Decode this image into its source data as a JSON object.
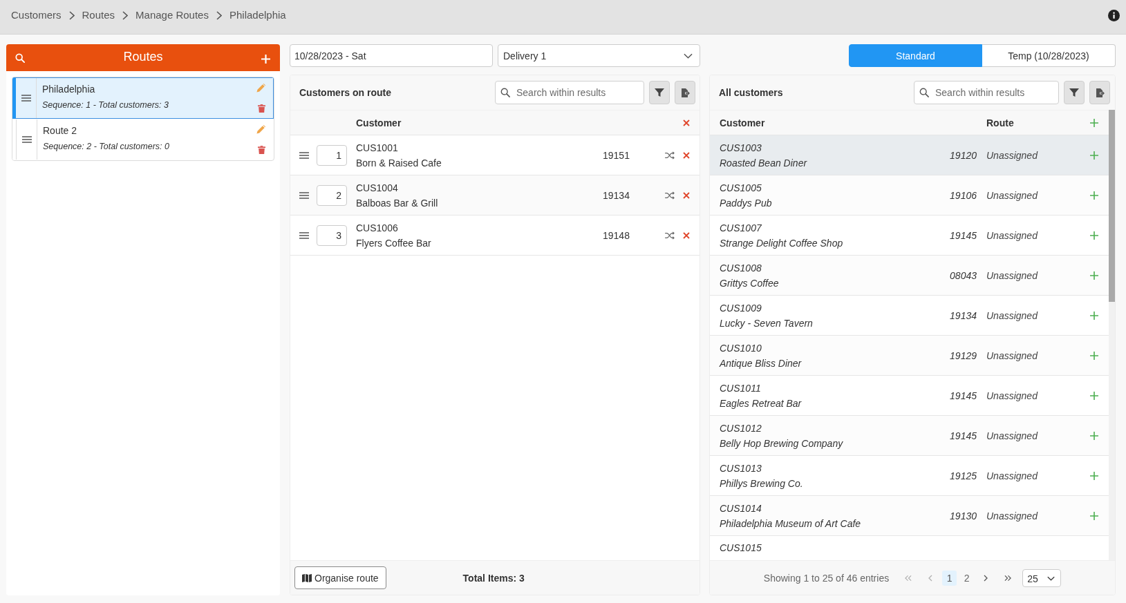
{
  "breadcrumbs": [
    {
      "label": "Customers"
    },
    {
      "label": "Routes"
    },
    {
      "label": "Manage Routes"
    },
    {
      "label": "Philadelphia"
    }
  ],
  "routes_panel": {
    "title": "Routes",
    "items": [
      {
        "name": "Philadelphia",
        "details": "Sequence: 1 - Total customers: 3",
        "selected": true
      },
      {
        "name": "Route 2",
        "details": "Sequence: 2 - Total customers: 0",
        "selected": false
      }
    ]
  },
  "date_field": {
    "value": "10/28/2023 - Sat"
  },
  "delivery_select": {
    "value": "Delivery 1"
  },
  "route_type_toggle": [
    {
      "label": "Standard",
      "selected": true
    },
    {
      "label": "Temp (10/28/2023)",
      "selected": false
    }
  ],
  "route_customers": {
    "title": "Customers on route",
    "search": {
      "placeholder": "Search within results"
    },
    "columns": [
      "Customer"
    ],
    "rows": [
      {
        "sequence": "1",
        "code": "CUS1001",
        "name": "Born & Raised Cafe",
        "column_3": "19151"
      },
      {
        "sequence": "2",
        "code": "CUS1004",
        "name": "Balboas Bar & Grill",
        "column_3": "19134"
      },
      {
        "sequence": "3",
        "code": "CUS1006",
        "name": "Flyers Coffee Bar",
        "column_3": "19148"
      }
    ],
    "organise_button": "Organise route",
    "total": "Total Items: 3"
  },
  "all_customers": {
    "title": "All customers",
    "search": {
      "placeholder": "Search within results"
    },
    "columns": [
      "Customer",
      "Route"
    ],
    "rows": [
      {
        "code": "CUS1003",
        "name": "Roasted Bean Diner",
        "column_2": "19120",
        "route": "Unassigned",
        "hovered": true
      },
      {
        "code": "CUS1005",
        "name": "Paddys Pub",
        "column_2": "19106",
        "route": "Unassigned",
        "hovered": false
      },
      {
        "code": "CUS1007",
        "name": "Strange Delight Coffee Shop",
        "column_2": "19145",
        "route": "Unassigned",
        "hovered": false
      },
      {
        "code": "CUS1008",
        "name": "Grittys Coffee",
        "column_2": "08043",
        "route": "Unassigned",
        "hovered": false
      },
      {
        "code": "CUS1009",
        "name": "Lucky - Seven Tavern",
        "column_2": "19134",
        "route": "Unassigned",
        "hovered": false
      },
      {
        "code": "CUS1010",
        "name": "Antique Bliss Diner",
        "column_2": "19129",
        "route": "Unassigned",
        "hovered": false
      },
      {
        "code": "CUS1011",
        "name": "Eagles Retreat Bar",
        "column_2": "19145",
        "route": "Unassigned",
        "hovered": false
      },
      {
        "code": "CUS1012",
        "name": "Belly Hop Brewing Company",
        "column_2": "19145",
        "route": "Unassigned",
        "hovered": false
      },
      {
        "code": "CUS1013",
        "name": "Phillys Brewing Co.",
        "column_2": "19125",
        "route": "Unassigned",
        "hovered": false
      },
      {
        "code": "CUS1014",
        "name": "Philadelphia Museum of Art Cafe",
        "column_2": "19130",
        "route": "Unassigned",
        "hovered": false
      },
      {
        "code": "CUS1015",
        "hovered": false
      }
    ],
    "pagination": {
      "summary": "Showing 1 to 25 of 46 entries",
      "first": {
        "disabled": true
      },
      "previous": {
        "disabled": true
      },
      "pages": [
        {
          "label": "1",
          "selected": true
        },
        {
          "label": "2",
          "selected": false
        }
      ],
      "next": {
        "disabled": false
      },
      "last": {
        "disabled": false
      },
      "page_size": "25"
    }
  }
}
